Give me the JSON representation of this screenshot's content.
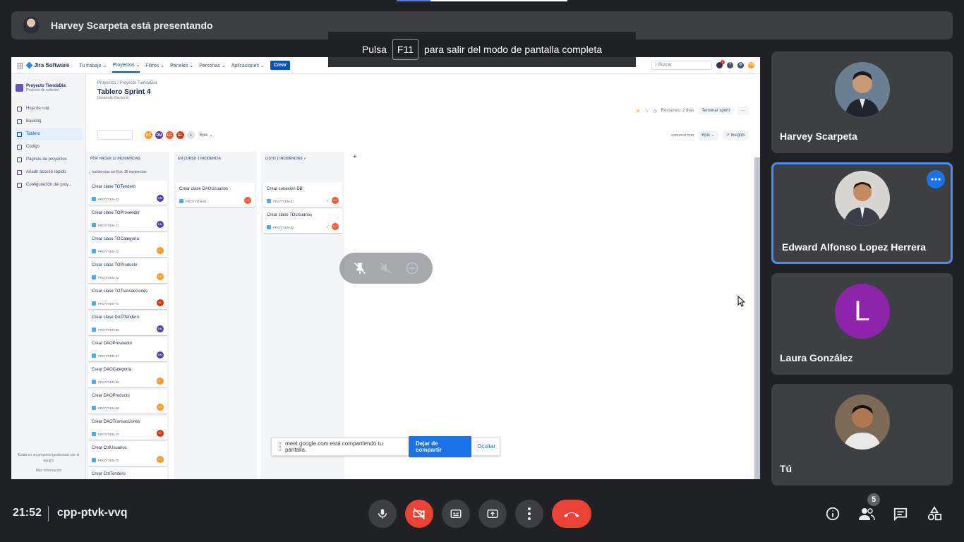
{
  "presenter": {
    "text": "Harvey Scarpeta está presentando"
  },
  "fullscreen_toast": {
    "before": "Pulsa",
    "key": "F11",
    "after": "para salir del modo de pantalla completa"
  },
  "jira": {
    "logo": "Jira Software",
    "nav": [
      "Tu trabajo ⌄",
      "Proyectos ⌄",
      "Filtros ⌄",
      "Paneles ⌄",
      "Personas ⌄",
      "Aplicaciones ⌄"
    ],
    "create_label": "Crear",
    "search_placeholder": "Buscar",
    "profile_initials": "HS",
    "project_name": "Proyecto TiendaDia",
    "project_type": "Proyecto de software",
    "sidebar": [
      "Hoja de ruta",
      "Backlog",
      "Tablero",
      "Código",
      "Páginas de proyectos",
      "Añadir acceso rápido",
      "Configuración del proy..."
    ],
    "sidebar_footer": "Estás en un proyecto gestionado por el equipo",
    "sidebar_more": "Más información",
    "breadcrumb": "Proyectos  /  Proyecto TiendaDia",
    "board_title": "Tablero Sprint 4",
    "board_subtitle": "Desarrollo Backend",
    "days_left": "Restantes: 2 días",
    "finish_sprint": "Terminar sprint",
    "more": "···",
    "avatars": [
      "HS",
      "DM",
      "LG",
      "EL"
    ],
    "epic_filter": "Epic ⌄",
    "group_by": "AGRUPAR POR",
    "group_value": "Epic ⌄",
    "insights": "Insights",
    "epic_line": "⌄ Incidencias sin Epic  15 incidencias",
    "columns": {
      "todo": {
        "title": "POR HACER 12 INCIDENCIAS",
        "issues": [
          {
            "title": "Crear clase TOTendero",
            "key": "PROYTIEN-63",
            "who": "DM"
          },
          {
            "title": "Crear clase TOProveedor",
            "key": "PROYTIEN-71",
            "who": "DM"
          },
          {
            "title": "Crear clase TOCategoría",
            "key": "PROYTIEN-73",
            "who": "HS"
          },
          {
            "title": "Crear clase TOProducto",
            "key": "PROYTIEN-72",
            "who": "HS"
          },
          {
            "title": "Crear clase TOTransacciones",
            "key": "PROYTIEN-74",
            "who": "EL"
          },
          {
            "title": "Crear clase DAOTendero",
            "key": "PROYTIEN-65",
            "who": "DM"
          },
          {
            "title": "Crear DAOProveedor",
            "key": "PROYTIEN-67",
            "who": "DM"
          },
          {
            "title": "Crear DAOCategoría",
            "key": "PROYTIEN-68",
            "who": "HS"
          },
          {
            "title": "Crear DAOProducto",
            "key": "PROYTIEN-69",
            "who": "HS"
          },
          {
            "title": "Crear DAOTransacciones",
            "key": "PROYTIEN-70",
            "who": "EL"
          },
          {
            "title": "Crear CtrlUsuarios",
            "key": "PROYTIEN-75",
            "who": "HS"
          },
          {
            "title": "Crear CtrlTendero",
            "key": "PROYTIEN-76",
            "who": "EL"
          }
        ]
      },
      "progress": {
        "title": "EN CURSO 1 INCIDENCIA",
        "issues": [
          {
            "title": "Crear clase DAOUsuarios",
            "key": "PROYTIEN-64",
            "who": "LG"
          }
        ]
      },
      "done": {
        "title": "LISTO 2 INCIDENCIAS  ✓",
        "issues": [
          {
            "title": "Crear conexión DB",
            "key": "PROYTIEN-61",
            "who": "LG"
          },
          {
            "title": "Crear clase TOUsuarios",
            "key": "PROYTIEN-62",
            "who": "LG"
          }
        ]
      }
    }
  },
  "share_bar": {
    "message": "meet.google.com está compartiendo tu pantalla.",
    "stop": "Dejar de compartir",
    "hide": "Ocultar"
  },
  "participants": [
    {
      "name": "Harvey Scarpeta"
    },
    {
      "name": "Edward Alfonso Lopez Herrera"
    },
    {
      "name": "Laura González",
      "initial": "L"
    },
    {
      "name": "Tú"
    }
  ],
  "footer": {
    "time": "21:52",
    "meeting_code": "cpp-ptvk-vvq",
    "people_count": "5"
  },
  "colors": {
    "bg": "#202124",
    "tile": "#3c4043",
    "red": "#ea4335",
    "blue": "#1a73e8",
    "purple": "#8e24aa"
  }
}
